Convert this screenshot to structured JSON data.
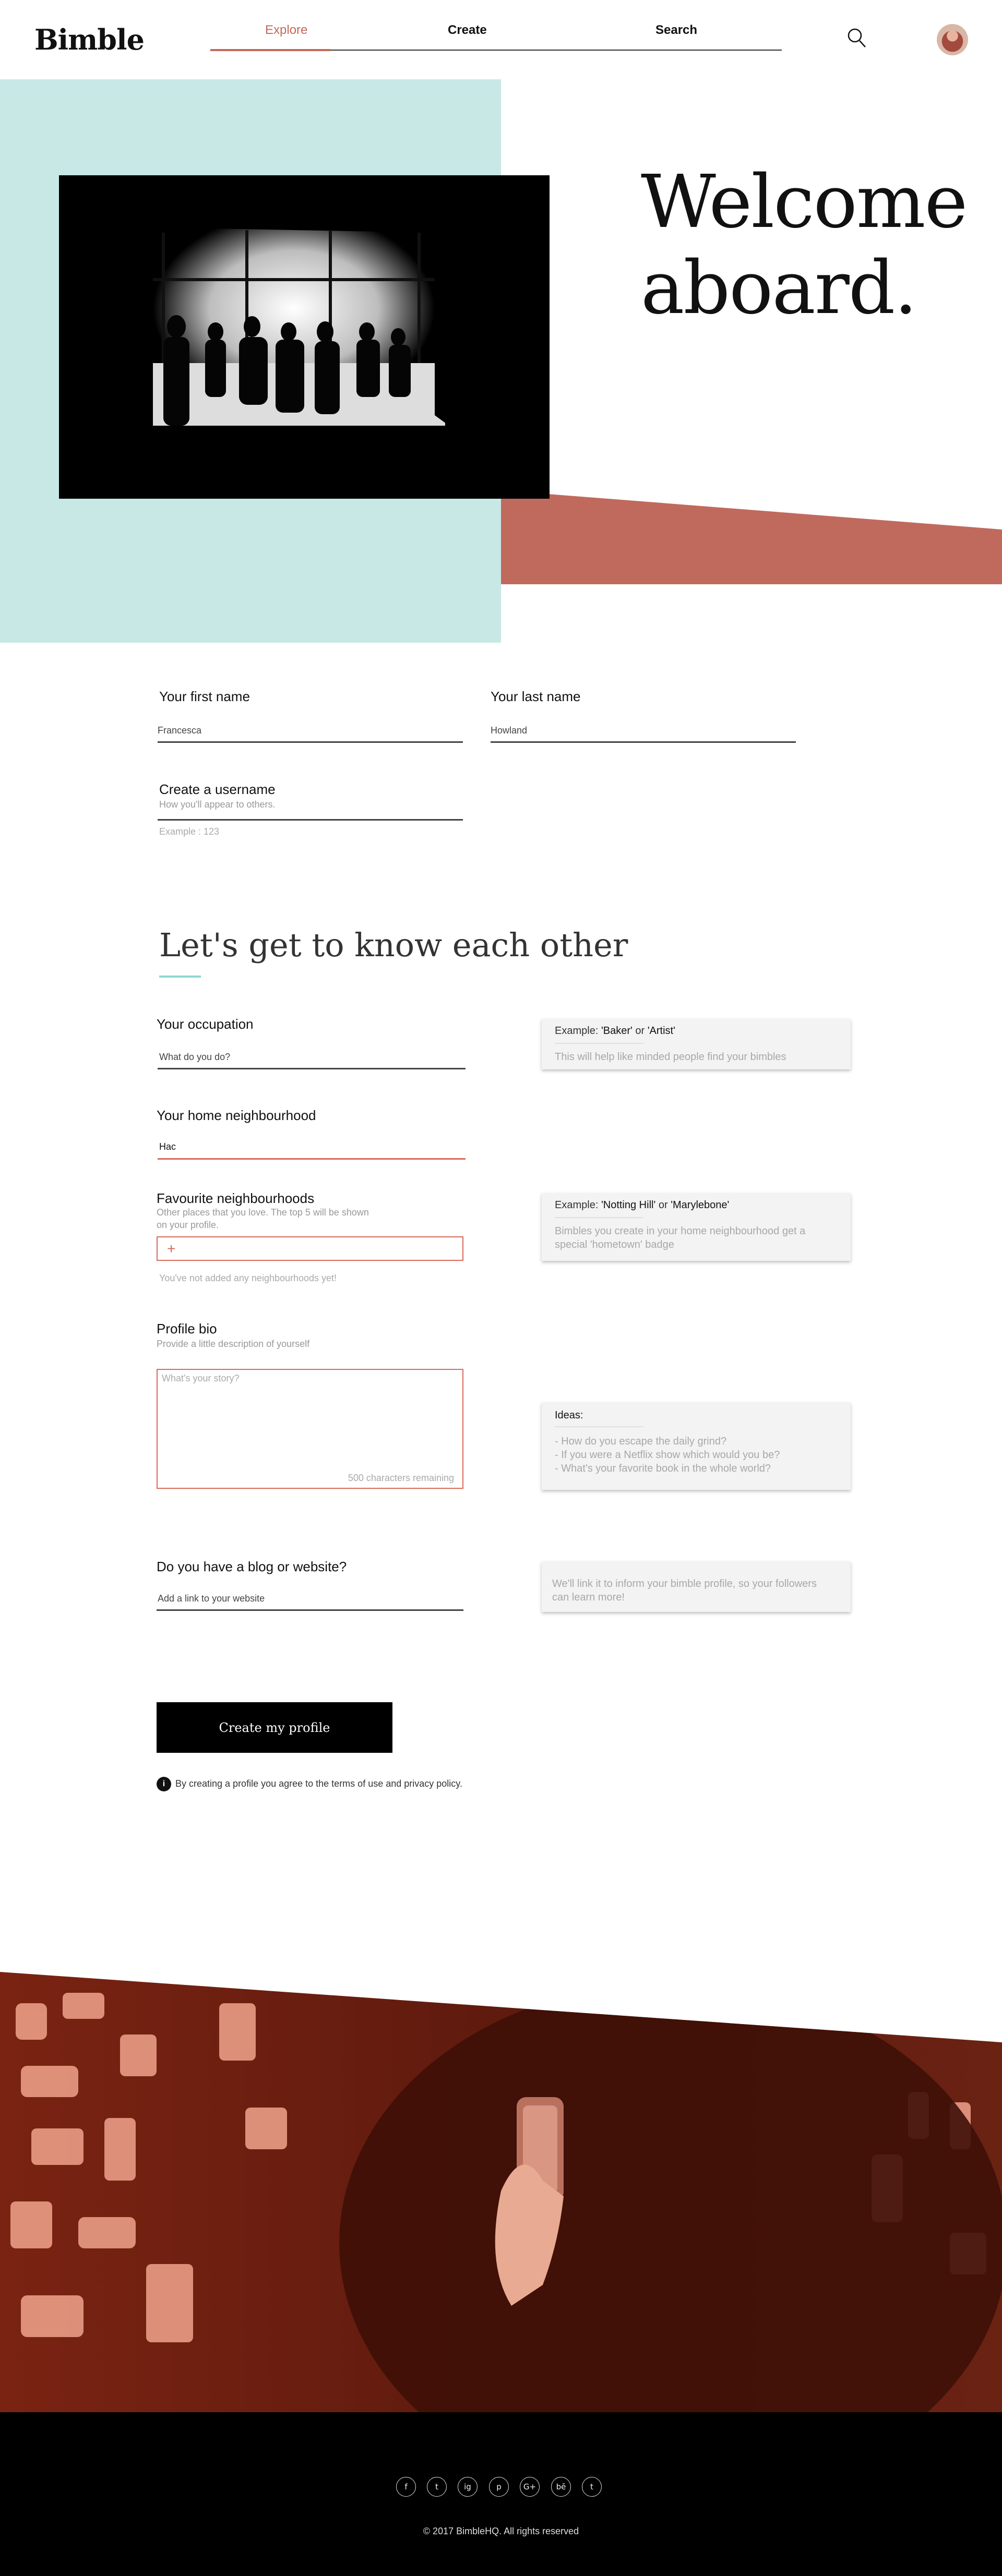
{
  "brand": {
    "logo": "Bimble"
  },
  "nav": {
    "explore": "Explore",
    "create": "Create",
    "search": "Search"
  },
  "hero": {
    "title_line1": "Welcome",
    "title_line2": "aboard."
  },
  "account": {
    "first_name_label": "Your first name",
    "first_name_value": "Francesca",
    "last_name_label": "Your last name",
    "last_name_value": "Howland",
    "username_label": "Create a username",
    "username_sublabel": "How you'll appear to others.",
    "username_hint": "Example : 123"
  },
  "about": {
    "title": "Let's get to know each other",
    "occupation_label": "Your occupation",
    "occupation_placeholder": "What do you do?",
    "occupation_card_prefix": "Example: ",
    "occupation_card_ex1": "'Baker'",
    "occupation_card_or": " or ",
    "occupation_card_ex2": "'Artist'",
    "occupation_card_text": "This will help like minded people find your bimbles",
    "home_label": "Your home neighbourhood",
    "home_value": "Hac",
    "fav_label": "Favourite neighbourhoods",
    "fav_sublabel": "Other places that you love. The top 5 will be shown on your profile.",
    "fav_add": "+",
    "fav_hint": "You've not added any neighbourhoods yet!",
    "fav_card_prefix": "Example: ",
    "fav_card_ex1": "'Notting Hill'",
    "fav_card_or": " or ",
    "fav_card_ex2": "'Marylebone'",
    "fav_card_text": "Bimbles you create in your home neighbourhood get a special 'hometown' badge",
    "bio_label": "Profile bio",
    "bio_sublabel": "Provide a little description of yourself",
    "bio_placeholder": "What's your story?",
    "bio_counter": "500 characters remaining",
    "ideas_title": "Ideas:",
    "ideas": [
      "- How do you escape the daily grind?",
      "- If you were a Netflix show which would you be?",
      "- What's your favorite book in the whole world?"
    ],
    "blog_label": "Do you have a blog or website?",
    "blog_placeholder": "Add a link to your website",
    "blog_card_text": "We'll link it to inform your bimble profile, so your followers can learn more!"
  },
  "submit": {
    "button": "Create my profile",
    "terms_icon": "i",
    "terms": "By creating a profile you agree to the terms of use and privacy policy."
  },
  "footer": {
    "social": [
      "f",
      "t",
      "ig",
      "p",
      "G+",
      "bē",
      "t"
    ],
    "social_icons": [
      "facebook-icon",
      "twitter-icon",
      "instagram-icon",
      "pinterest-icon",
      "google-plus-icon",
      "behance-icon",
      "tumblr-icon"
    ],
    "copyright": "© 2017 BimbleHQ. All rights reserved"
  },
  "colors": {
    "accent": "#c4695a",
    "teal": "#c8e8e6",
    "coral_band": "#c06a5d",
    "underline": "#8fd6d1"
  }
}
